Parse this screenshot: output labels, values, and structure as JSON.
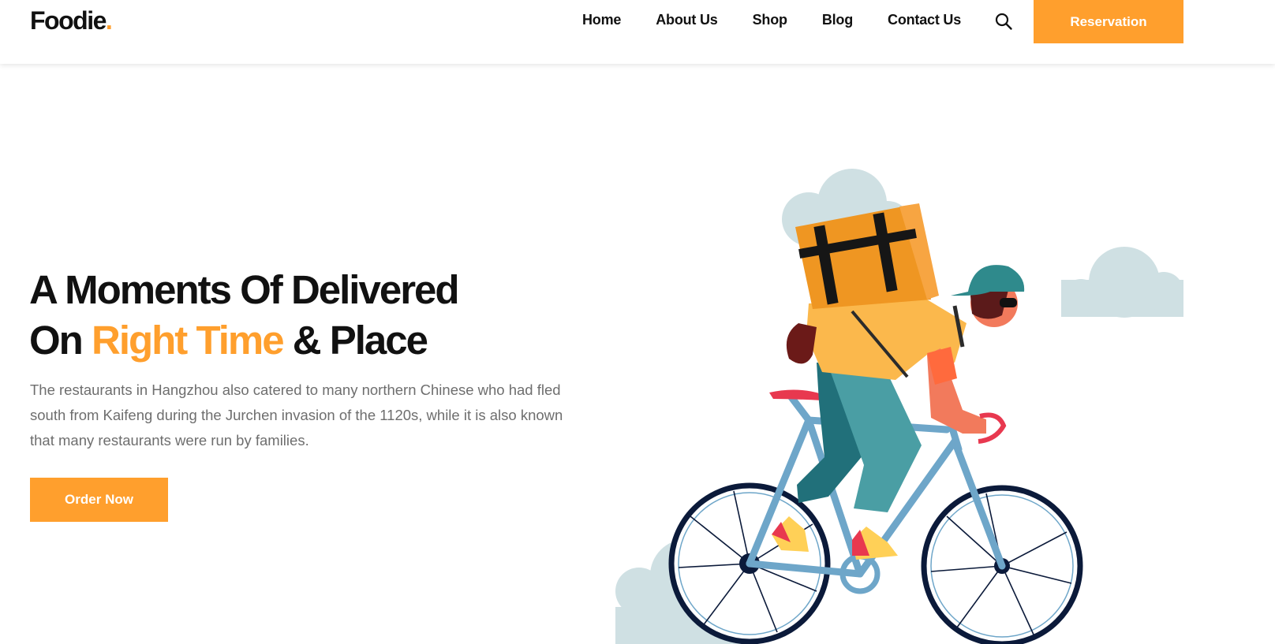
{
  "header": {
    "logo": {
      "text": "Foodie",
      "dot": "."
    },
    "nav": [
      {
        "label": "Home"
      },
      {
        "label": "About Us"
      },
      {
        "label": "Shop"
      },
      {
        "label": "Blog"
      },
      {
        "label": "Contact Us"
      }
    ],
    "search_icon": "search-icon",
    "reservation_label": "Reservation"
  },
  "hero": {
    "title_line1": "A Moments Of Delivered",
    "title_line2_prefix": "On ",
    "title_line2_accent": "Right Time",
    "title_line2_suffix": " & Place",
    "description": "The restaurants in Hangzhou also catered to many northern Chinese who had fled south from Kaifeng during the Jurchen invasion of the 1120s, while it is also known that many restaurants were run by families.",
    "order_label": "Order Now"
  },
  "colors": {
    "accent": "#ff9f2d",
    "heading": "#111111",
    "body_text": "#6e6e6e",
    "cloud": "#cfe0e3"
  }
}
